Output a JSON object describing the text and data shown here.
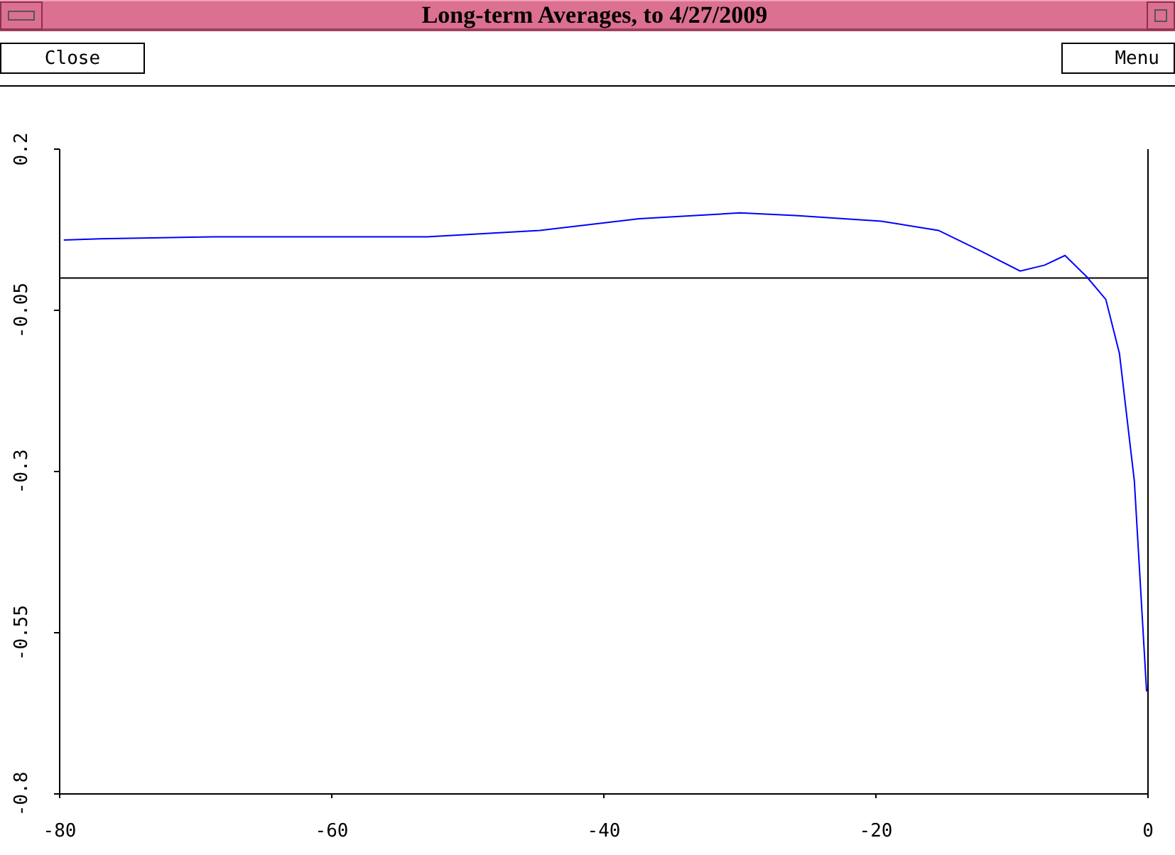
{
  "window": {
    "title": "Long-term Averages, to 4/27/2009"
  },
  "toolbar": {
    "buttons": [
      {
        "label": "Close",
        "kind": "left"
      },
      {
        "label": "Menu",
        "kind": "right"
      }
    ]
  },
  "chart": {
    "chart_data": {
      "type": "line",
      "x": [
        -79.7,
        -77,
        -68.7,
        -53,
        -44.7,
        -37.4,
        -30,
        -25.9,
        -19.6,
        -15.4,
        -12.3,
        -9.4,
        -7.6,
        -6.1,
        -4.5,
        -3.1,
        -2.1,
        -1,
        -0.1
      ],
      "series": [
        {
          "color": "#0000ff",
          "values": [
            0.059,
            0.061,
            0.064,
            0.064,
            0.074,
            0.092,
            0.101,
            0.097,
            0.088,
            0.074,
            0.042,
            0.011,
            0.02,
            0.035,
            0.002,
            -0.033,
            -0.117,
            -0.315,
            -0.641
          ]
        }
      ],
      "xlim": [
        -80,
        0
      ],
      "ylim": [
        -0.8,
        0.2
      ],
      "xticks": [
        -80,
        -60,
        -40,
        -20,
        0
      ],
      "yticks": [
        {
          "value": 0.2,
          "label": "0.2"
        },
        {
          "value": -0.05,
          "label": "-0.05"
        },
        {
          "value": -0.3,
          "label": "-0.3"
        },
        {
          "value": -0.55,
          "label": "-0.55"
        },
        {
          "value": -0.8,
          "label": "-0.8"
        }
      ]
    }
  }
}
